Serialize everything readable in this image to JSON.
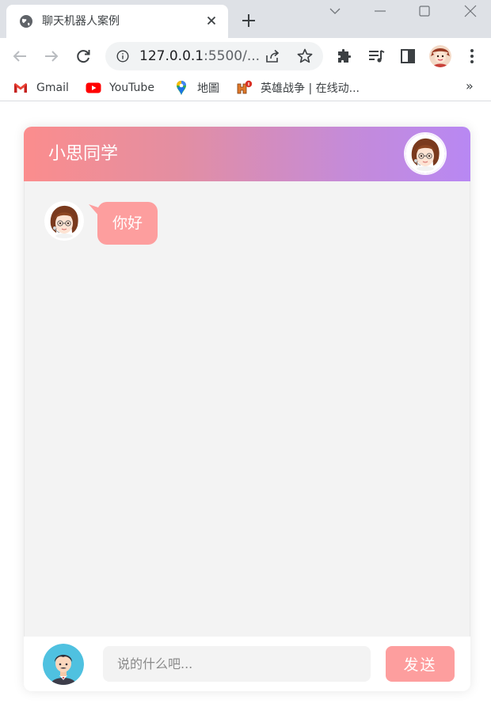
{
  "browser": {
    "tab_title": "聊天机器人案例",
    "url_host": "127.0.0.1",
    "url_rest": ":5500/...",
    "bookmarks": [
      {
        "label": "Gmail",
        "icon": "gmail-icon"
      },
      {
        "label": "YouTube",
        "icon": "youtube-icon"
      },
      {
        "label": "地圖",
        "icon": "maps-icon"
      },
      {
        "label": "英雄战争 | 在线动...",
        "icon": "hero-war-icon"
      }
    ],
    "bookmarks_more": "»"
  },
  "chat": {
    "title": "小思同学",
    "messages": [
      {
        "from": "bot",
        "text": "你好"
      }
    ],
    "input_placeholder": "说的什么吧...",
    "input_value": "",
    "send_label": "发送"
  },
  "colors": {
    "header_gradient_start": "#fb8d8d",
    "header_gradient_end": "#b888f3",
    "bubble": "#fd9e9e",
    "send_button": "#fd9e9e",
    "chat_background": "#f3f3f3"
  }
}
